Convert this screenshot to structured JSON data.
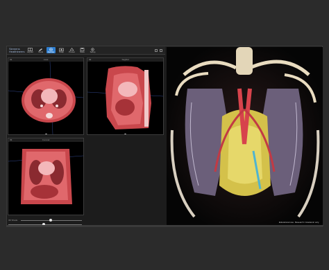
{
  "app": {
    "logo": "Siemens Healthineers",
    "toolbar": [
      {
        "icon": "layout-icon",
        "label": "Layout",
        "active": false
      },
      {
        "icon": "tools-icon",
        "label": "Tools",
        "active": false
      },
      {
        "icon": "cinematic-render-icon",
        "label": "Render",
        "active": true
      },
      {
        "icon": "camera-icon",
        "label": "Snap",
        "active": false
      },
      {
        "icon": "presets-icon",
        "label": "Preset",
        "active": false
      },
      {
        "icon": "save-icon",
        "label": "Save",
        "active": false
      },
      {
        "icon": "settings-icon",
        "label": "Setup",
        "active": false
      }
    ]
  },
  "viewports": {
    "axial": {
      "number": "01",
      "title": "Axial"
    },
    "sagittal": {
      "number": "02",
      "title": "Sagittal"
    },
    "coronal": {
      "number": "03",
      "title": "Coronal"
    }
  },
  "render": {
    "caption": "Educational use. Research / Academic only."
  },
  "bottom": {
    "label": "3D Shade"
  },
  "colors": {
    "active": "#2f7fd1",
    "tissue": "#d8585c",
    "background": "#2b2b2b"
  }
}
